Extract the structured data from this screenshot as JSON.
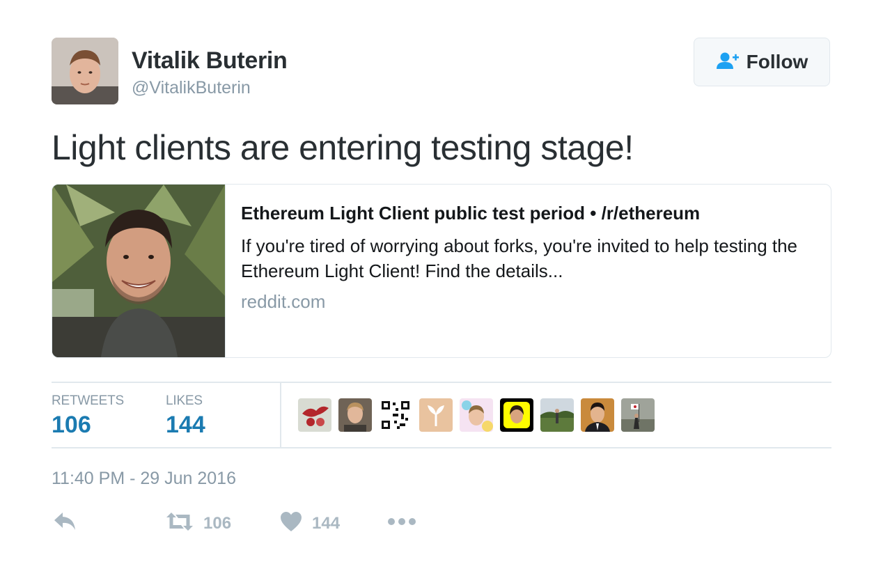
{
  "author": {
    "display_name": "Vitalik Buterin",
    "username": "@VitalikButerin"
  },
  "follow_button": {
    "label": "Follow"
  },
  "tweet": {
    "text": "Light clients are entering testing stage!"
  },
  "card": {
    "title": "Ethereum Light Client public test period • /r/ethereum",
    "description": "If you're tired of worrying about forks, you're invited to help testing the Ethereum Light Client! Find the details...",
    "domain": "reddit.com"
  },
  "stats": {
    "retweets_label": "RETWEETS",
    "retweets_value": "106",
    "likes_label": "LIKES",
    "likes_value": "144"
  },
  "timestamp": "11:40 PM - 29 Jun 2016",
  "actions": {
    "retweet_count": "106",
    "like_count": "144"
  },
  "colors": {
    "link_blue": "#1b7bb1",
    "muted_gray": "#8899a6",
    "border": "#e1e8ed",
    "follow_icon_blue": "#1da1f2"
  },
  "icons": {
    "reply": "reply-icon",
    "retweet": "retweet-icon",
    "like": "heart-icon",
    "more": "more-icon",
    "follow": "follow-person-plus-icon"
  }
}
